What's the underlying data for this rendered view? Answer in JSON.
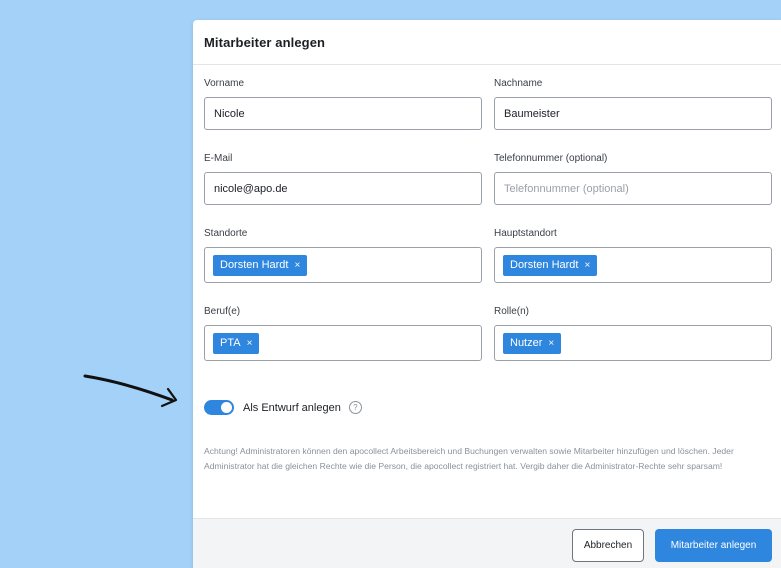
{
  "modal": {
    "title": "Mitarbeiter anlegen"
  },
  "fields": {
    "vorname": {
      "label": "Vorname",
      "value": "Nicole"
    },
    "nachname": {
      "label": "Nachname",
      "value": "Baumeister"
    },
    "email": {
      "label": "E-Mail",
      "value": "nicole@apo.de"
    },
    "telefon": {
      "label": "Telefonnummer (optional)",
      "placeholder": "Telefonnummer (optional)"
    },
    "standorte": {
      "label": "Standorte",
      "tag": "Dorsten Hardt"
    },
    "hauptstandort": {
      "label": "Hauptstandort",
      "tag": "Dorsten Hardt"
    },
    "beruf": {
      "label": "Beruf(e)",
      "tag": "PTA"
    },
    "rolle": {
      "label": "Rolle(n)",
      "tag": "Nutzer"
    }
  },
  "toggle": {
    "label": "Als Entwurf anlegen",
    "checked": true,
    "help_icon": "?"
  },
  "tag_remove_glyph": "×",
  "warning_text": "Achtung! Administratoren können den apocollect Arbeitsbereich und Buchungen verwalten sowie Mitarbeiter hinzufügen und löschen. Jeder Administrator hat die gleichen Rechte wie die Person, die apocollect registriert hat. Vergib daher die Administrator-Rechte sehr sparsam!",
  "footer": {
    "cancel_label": "Abbrechen",
    "submit_label": "Mitarbeiter anlegen"
  },
  "colors": {
    "accent": "#2e86de",
    "background": "#a3d1f7"
  }
}
